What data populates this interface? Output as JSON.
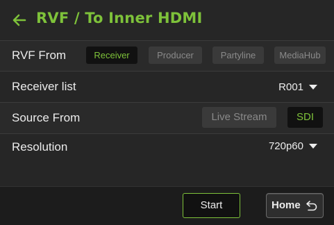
{
  "header": {
    "title": "RVF / To Inner HDMI",
    "back_icon": "arrow-left-icon"
  },
  "rvf_from": {
    "label": "RVF From",
    "options": [
      "Receiver",
      "Producer",
      "Partyline",
      "MediaHub"
    ],
    "selected": "Receiver"
  },
  "receiver_list": {
    "label": "Receiver list",
    "value": "R001"
  },
  "source_from": {
    "label": "Source From",
    "options": [
      "Live Stream",
      "SDI"
    ],
    "selected": "SDI"
  },
  "resolution": {
    "label": "Resolution",
    "value": "720p60"
  },
  "footer": {
    "start_label": "Start",
    "home_label": "Home",
    "home_icon": "return-icon"
  },
  "colors": {
    "accent": "#7ec23a",
    "background": "#262626",
    "footer_background": "#1c1c1c",
    "text": "#ececec",
    "inactive_text": "#8a8a8a",
    "inactive_button": "#3a3a3a",
    "active_button": "#111111"
  }
}
